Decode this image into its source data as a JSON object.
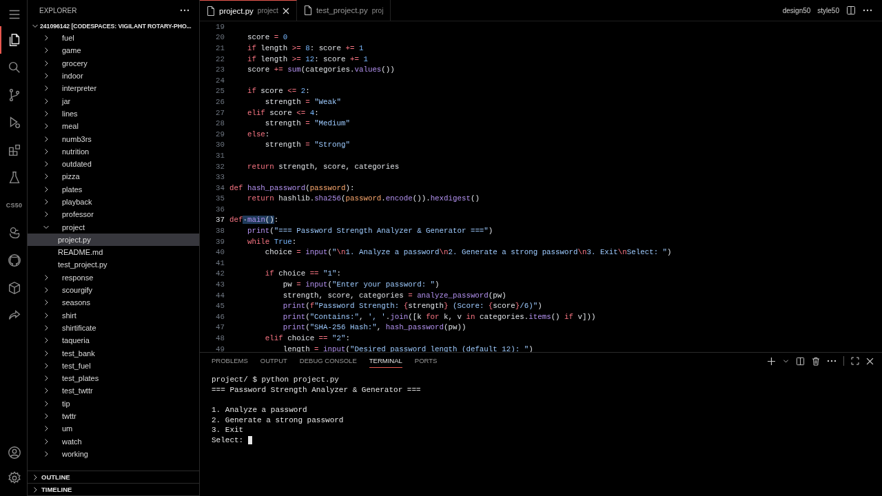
{
  "activity_bar": {
    "top": [
      {
        "kind": "menu",
        "selected": false
      },
      {
        "kind": "files",
        "selected": true
      },
      {
        "kind": "search",
        "selected": false
      },
      {
        "kind": "source-control",
        "selected": false
      },
      {
        "kind": "run",
        "selected": false
      },
      {
        "kind": "extensions",
        "selected": false
      },
      {
        "kind": "testing",
        "selected": false
      },
      {
        "kind": "text",
        "label": "CS50",
        "selected": false
      },
      {
        "kind": "duck",
        "selected": false
      },
      {
        "kind": "github",
        "selected": false
      },
      {
        "kind": "remote",
        "selected": false
      },
      {
        "kind": "share",
        "selected": false
      }
    ],
    "bottom": [
      {
        "kind": "account",
        "selected": false
      },
      {
        "kind": "settings",
        "selected": false
      }
    ]
  },
  "explorer": {
    "title": "EXPLORER",
    "root": {
      "label": "241096142 [CODESPACES: VIGILANT ROTARY-PHO...",
      "expanded": true,
      "children": [
        {
          "label": "fuel",
          "kind": "folder",
          "expanded": false,
          "selected": false
        },
        {
          "label": "game",
          "kind": "folder",
          "expanded": false,
          "selected": false
        },
        {
          "label": "grocery",
          "kind": "folder",
          "expanded": false,
          "selected": false
        },
        {
          "label": "indoor",
          "kind": "folder",
          "expanded": false,
          "selected": false
        },
        {
          "label": "interpreter",
          "kind": "folder",
          "expanded": false,
          "selected": false
        },
        {
          "label": "jar",
          "kind": "folder",
          "expanded": false,
          "selected": false
        },
        {
          "label": "lines",
          "kind": "folder",
          "expanded": false,
          "selected": false
        },
        {
          "label": "meal",
          "kind": "folder",
          "expanded": false,
          "selected": false
        },
        {
          "label": "numb3rs",
          "kind": "folder",
          "expanded": false,
          "selected": false
        },
        {
          "label": "nutrition",
          "kind": "folder",
          "expanded": false,
          "selected": false
        },
        {
          "label": "outdated",
          "kind": "folder",
          "expanded": false,
          "selected": false
        },
        {
          "label": "pizza",
          "kind": "folder",
          "expanded": false,
          "selected": false
        },
        {
          "label": "plates",
          "kind": "folder",
          "expanded": false,
          "selected": false
        },
        {
          "label": "playback",
          "kind": "folder",
          "expanded": false,
          "selected": false
        },
        {
          "label": "professor",
          "kind": "folder",
          "expanded": false,
          "selected": false
        },
        {
          "label": "project",
          "kind": "folder",
          "expanded": true,
          "selected": false,
          "children": [
            {
              "label": "project.py",
              "kind": "file",
              "selected": true
            },
            {
              "label": "README.md",
              "kind": "file",
              "selected": false
            },
            {
              "label": "test_project.py",
              "kind": "file",
              "selected": false
            }
          ]
        },
        {
          "label": "response",
          "kind": "folder",
          "expanded": false,
          "selected": false
        },
        {
          "label": "scourgify",
          "kind": "folder",
          "expanded": false,
          "selected": false
        },
        {
          "label": "seasons",
          "kind": "folder",
          "expanded": false,
          "selected": false
        },
        {
          "label": "shirt",
          "kind": "folder",
          "expanded": false,
          "selected": false
        },
        {
          "label": "shirtificate",
          "kind": "folder",
          "expanded": false,
          "selected": false
        },
        {
          "label": "taqueria",
          "kind": "folder",
          "expanded": false,
          "selected": false
        },
        {
          "label": "test_bank",
          "kind": "folder",
          "expanded": false,
          "selected": false
        },
        {
          "label": "test_fuel",
          "kind": "folder",
          "expanded": false,
          "selected": false
        },
        {
          "label": "test_plates",
          "kind": "folder",
          "expanded": false,
          "selected": false
        },
        {
          "label": "test_twttr",
          "kind": "folder",
          "expanded": false,
          "selected": false
        },
        {
          "label": "tip",
          "kind": "folder",
          "expanded": false,
          "selected": false
        },
        {
          "label": "twttr",
          "kind": "folder",
          "expanded": false,
          "selected": false
        },
        {
          "label": "um",
          "kind": "folder",
          "expanded": false,
          "selected": false
        },
        {
          "label": "watch",
          "kind": "folder",
          "expanded": false,
          "selected": false
        },
        {
          "label": "working",
          "kind": "folder",
          "expanded": false,
          "selected": false
        }
      ]
    },
    "sections": [
      {
        "label": "OUTLINE",
        "expanded": false
      },
      {
        "label": "TIMELINE",
        "expanded": false
      }
    ]
  },
  "editor": {
    "tabs": [
      {
        "label": "project.py",
        "description": "project",
        "selected": true,
        "closable": true
      },
      {
        "label": "test_project.py",
        "description": "proj",
        "selected": false,
        "closable": false
      }
    ],
    "actions": [
      "design50",
      "style50"
    ],
    "lines": [
      {
        "n": "19",
        "current": false
      },
      {
        "n": "20",
        "current": false,
        "tokens": [
          {
            "text": "    score ",
            "kind": "plain"
          },
          {
            "text": "= ",
            "kind": "operator"
          },
          {
            "text": "0",
            "kind": "number"
          }
        ]
      },
      {
        "n": "21",
        "current": false,
        "tokens": [
          {
            "text": "    if",
            "kind": "keyword"
          },
          {
            "text": " length ",
            "kind": "plain"
          },
          {
            "text": ">= ",
            "kind": "operator"
          },
          {
            "text": "8",
            "kind": "number"
          },
          {
            "text": ": score ",
            "kind": "plain"
          },
          {
            "text": "+= ",
            "kind": "operator"
          },
          {
            "text": "1",
            "kind": "number"
          }
        ]
      },
      {
        "n": "22",
        "current": false,
        "tokens": [
          {
            "text": "    if",
            "kind": "keyword"
          },
          {
            "text": " length ",
            "kind": "plain"
          },
          {
            "text": ">= ",
            "kind": "operator"
          },
          {
            "text": "12",
            "kind": "number"
          },
          {
            "text": ": score ",
            "kind": "plain"
          },
          {
            "text": "+= ",
            "kind": "operator"
          },
          {
            "text": "1",
            "kind": "number"
          }
        ]
      },
      {
        "n": "23",
        "current": false,
        "tokens": [
          {
            "text": "    score ",
            "kind": "plain"
          },
          {
            "text": "+= ",
            "kind": "operator"
          },
          {
            "text": "sum",
            "kind": "function"
          },
          {
            "text": "(categories.",
            "kind": "plain"
          },
          {
            "text": "values",
            "kind": "function"
          },
          {
            "text": "())",
            "kind": "plain"
          }
        ]
      },
      {
        "n": "24",
        "current": false
      },
      {
        "n": "25",
        "current": false,
        "tokens": [
          {
            "text": "    if",
            "kind": "keyword"
          },
          {
            "text": " score ",
            "kind": "plain"
          },
          {
            "text": "<= ",
            "kind": "operator"
          },
          {
            "text": "2",
            "kind": "number"
          },
          {
            "text": ":",
            "kind": "plain"
          }
        ]
      },
      {
        "n": "26",
        "current": false,
        "tokens": [
          {
            "text": "        strength ",
            "kind": "plain"
          },
          {
            "text": "= ",
            "kind": "operator"
          },
          {
            "text": "\"Weak\"",
            "kind": "string"
          }
        ]
      },
      {
        "n": "27",
        "current": false,
        "tokens": [
          {
            "text": "    elif",
            "kind": "keyword"
          },
          {
            "text": " score ",
            "kind": "plain"
          },
          {
            "text": "<= ",
            "kind": "operator"
          },
          {
            "text": "4",
            "kind": "number"
          },
          {
            "text": ":",
            "kind": "plain"
          }
        ]
      },
      {
        "n": "28",
        "current": false,
        "tokens": [
          {
            "text": "        strength ",
            "kind": "plain"
          },
          {
            "text": "= ",
            "kind": "operator"
          },
          {
            "text": "\"Medium\"",
            "kind": "string"
          }
        ]
      },
      {
        "n": "29",
        "current": false,
        "tokens": [
          {
            "text": "    else",
            "kind": "keyword"
          },
          {
            "text": ":",
            "kind": "plain"
          }
        ]
      },
      {
        "n": "30",
        "current": false,
        "tokens": [
          {
            "text": "        strength ",
            "kind": "plain"
          },
          {
            "text": "= ",
            "kind": "operator"
          },
          {
            "text": "\"Strong\"",
            "kind": "string"
          }
        ]
      },
      {
        "n": "31",
        "current": false
      },
      {
        "n": "32",
        "current": false,
        "tokens": [
          {
            "text": "    return",
            "kind": "keyword"
          },
          {
            "text": " strength, score, categories",
            "kind": "plain"
          }
        ]
      },
      {
        "n": "33",
        "current": false
      },
      {
        "n": "34",
        "current": false,
        "tokens": [
          {
            "text": "def ",
            "kind": "keyword"
          },
          {
            "text": "hash_password",
            "kind": "function"
          },
          {
            "text": "(",
            "kind": "plain"
          },
          {
            "text": "password",
            "kind": "parameter"
          },
          {
            "text": "):",
            "kind": "plain"
          }
        ]
      },
      {
        "n": "35",
        "current": false,
        "tokens": [
          {
            "text": "    return",
            "kind": "keyword"
          },
          {
            "text": " hashlib.",
            "kind": "plain"
          },
          {
            "text": "sha256",
            "kind": "function"
          },
          {
            "text": "(",
            "kind": "plain"
          },
          {
            "text": "password",
            "kind": "parameter"
          },
          {
            "text": ".",
            "kind": "plain"
          },
          {
            "text": "encode",
            "kind": "function"
          },
          {
            "text": "()).",
            "kind": "plain"
          },
          {
            "text": "hexdigest",
            "kind": "function"
          },
          {
            "text": "()",
            "kind": "plain"
          }
        ]
      },
      {
        "n": "36",
        "current": false
      },
      {
        "n": "37",
        "current": true,
        "tokens": [
          {
            "text": "def",
            "kind": "keyword"
          },
          {
            "text": "·",
            "kind": "selection"
          },
          {
            "text": "main",
            "kind": "selected-function"
          },
          {
            "text": "()",
            "kind": "selection"
          },
          {
            "text": ":",
            "kind": "plain"
          }
        ]
      },
      {
        "n": "38",
        "current": false,
        "tokens": [
          {
            "text": "    print",
            "kind": "function"
          },
          {
            "text": "(",
            "kind": "plain"
          },
          {
            "text": "\"=== Password Strength Analyzer & Generator ===\"",
            "kind": "string"
          },
          {
            "text": ")",
            "kind": "plain"
          }
        ]
      },
      {
        "n": "39",
        "current": false,
        "tokens": [
          {
            "text": "    while ",
            "kind": "keyword"
          },
          {
            "text": "True",
            "kind": "constant"
          },
          {
            "text": ":",
            "kind": "plain"
          }
        ]
      },
      {
        "n": "40",
        "current": false,
        "tokens": [
          {
            "text": "        choice ",
            "kind": "plain"
          },
          {
            "text": "= ",
            "kind": "operator"
          },
          {
            "text": "input",
            "kind": "function"
          },
          {
            "text": "(",
            "kind": "plain"
          },
          {
            "text": "\"",
            "kind": "string"
          },
          {
            "text": "\\n",
            "kind": "escape"
          },
          {
            "text": "1. Analyze a password",
            "kind": "string"
          },
          {
            "text": "\\n",
            "kind": "escape"
          },
          {
            "text": "2. Generate a strong password",
            "kind": "string"
          },
          {
            "text": "\\n",
            "kind": "escape"
          },
          {
            "text": "3. Exit",
            "kind": "string"
          },
          {
            "text": "\\n",
            "kind": "escape"
          },
          {
            "text": "Select: \"",
            "kind": "string"
          },
          {
            "text": ")",
            "kind": "plain"
          }
        ]
      },
      {
        "n": "41",
        "current": false
      },
      {
        "n": "42",
        "current": false,
        "tokens": [
          {
            "text": "        if",
            "kind": "keyword"
          },
          {
            "text": " choice ",
            "kind": "plain"
          },
          {
            "text": "== ",
            "kind": "operator"
          },
          {
            "text": "\"1\"",
            "kind": "string"
          },
          {
            "text": ":",
            "kind": "plain"
          }
        ]
      },
      {
        "n": "43",
        "current": false,
        "tokens": [
          {
            "text": "            pw ",
            "kind": "plain"
          },
          {
            "text": "= ",
            "kind": "operator"
          },
          {
            "text": "input",
            "kind": "function"
          },
          {
            "text": "(",
            "kind": "plain"
          },
          {
            "text": "\"Enter your password: \"",
            "kind": "string"
          },
          {
            "text": ")",
            "kind": "plain"
          }
        ]
      },
      {
        "n": "44",
        "current": false,
        "tokens": [
          {
            "text": "            strength, score, categories ",
            "kind": "plain"
          },
          {
            "text": "= ",
            "kind": "operator"
          },
          {
            "text": "analyze_password",
            "kind": "function"
          },
          {
            "text": "(pw)",
            "kind": "plain"
          }
        ]
      },
      {
        "n": "45",
        "current": false,
        "tokens": [
          {
            "text": "            print",
            "kind": "function"
          },
          {
            "text": "(",
            "kind": "plain"
          },
          {
            "text": "f",
            "kind": "keyword"
          },
          {
            "text": "\"Password Strength: ",
            "kind": "string"
          },
          {
            "text": "{",
            "kind": "keyword"
          },
          {
            "text": "strength",
            "kind": "plain"
          },
          {
            "text": "}",
            "kind": "keyword"
          },
          {
            "text": " (Score: ",
            "kind": "string"
          },
          {
            "text": "{",
            "kind": "keyword"
          },
          {
            "text": "score",
            "kind": "plain"
          },
          {
            "text": "}",
            "kind": "keyword"
          },
          {
            "text": "/6)\"",
            "kind": "string"
          },
          {
            "text": ")",
            "kind": "plain"
          }
        ]
      },
      {
        "n": "46",
        "current": false,
        "tokens": [
          {
            "text": "            print",
            "kind": "function"
          },
          {
            "text": "(",
            "kind": "plain"
          },
          {
            "text": "\"Contains:\"",
            "kind": "string"
          },
          {
            "text": ", ",
            "kind": "plain"
          },
          {
            "text": "', '",
            "kind": "string"
          },
          {
            "text": ".",
            "kind": "plain"
          },
          {
            "text": "join",
            "kind": "function"
          },
          {
            "text": "([k ",
            "kind": "plain"
          },
          {
            "text": "for",
            "kind": "keyword"
          },
          {
            "text": " k, v ",
            "kind": "plain"
          },
          {
            "text": "in",
            "kind": "keyword"
          },
          {
            "text": " categories.",
            "kind": "plain"
          },
          {
            "text": "items",
            "kind": "function"
          },
          {
            "text": "() ",
            "kind": "plain"
          },
          {
            "text": "if",
            "kind": "keyword"
          },
          {
            "text": " v]))",
            "kind": "plain"
          }
        ]
      },
      {
        "n": "47",
        "current": false,
        "tokens": [
          {
            "text": "            print",
            "kind": "function"
          },
          {
            "text": "(",
            "kind": "plain"
          },
          {
            "text": "\"SHA-256 Hash:\"",
            "kind": "string"
          },
          {
            "text": ", ",
            "kind": "plain"
          },
          {
            "text": "hash_password",
            "kind": "function"
          },
          {
            "text": "(pw))",
            "kind": "plain"
          }
        ]
      },
      {
        "n": "48",
        "current": false,
        "tokens": [
          {
            "text": "        elif",
            "kind": "keyword"
          },
          {
            "text": " choice ",
            "kind": "plain"
          },
          {
            "text": "== ",
            "kind": "operator"
          },
          {
            "text": "\"2\"",
            "kind": "string"
          },
          {
            "text": ":",
            "kind": "plain"
          }
        ]
      },
      {
        "n": "49",
        "current": false,
        "tokens": [
          {
            "text": "            length ",
            "kind": "plain"
          },
          {
            "text": "= ",
            "kind": "operator"
          },
          {
            "text": "input",
            "kind": "function"
          },
          {
            "text": "(",
            "kind": "plain"
          },
          {
            "text": "\"Desired password length (default 12): \"",
            "kind": "string"
          },
          {
            "text": ")",
            "kind": "plain"
          }
        ]
      }
    ]
  },
  "panel": {
    "tabs": [
      {
        "label": "PROBLEMS",
        "selected": false
      },
      {
        "label": "OUTPUT",
        "selected": false
      },
      {
        "label": "DEBUG CONSOLE",
        "selected": false
      },
      {
        "label": "TERMINAL",
        "selected": true
      },
      {
        "label": "PORTS",
        "selected": false
      }
    ],
    "terminal": [
      {
        "text": "project/ $ python project.py",
        "gap_before": false,
        "cursor": false
      },
      {
        "text": "=== Password Strength Analyzer & Generator ===",
        "gap_before": false,
        "cursor": false
      },
      {
        "text": "1. Analyze a password",
        "gap_before": true,
        "cursor": false
      },
      {
        "text": "2. Generate a strong password",
        "gap_before": false,
        "cursor": false
      },
      {
        "text": "3. Exit",
        "gap_before": false,
        "cursor": false
      },
      {
        "text": "Select: ",
        "gap_before": false,
        "cursor": true
      }
    ]
  }
}
